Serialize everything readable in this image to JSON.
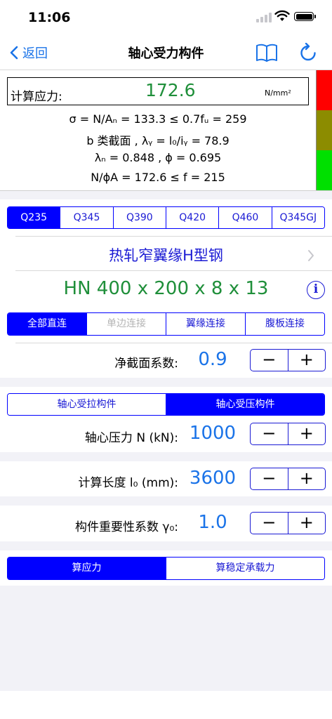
{
  "status": {
    "time": "11:06"
  },
  "nav": {
    "back_label": "返回",
    "title": "轴心受力构件"
  },
  "result": {
    "stress_label": "计算应力:",
    "stress_value": "172.6",
    "stress_unit": "N/mm²",
    "line1": "σ = N/Aₙ = 133.3 ≤ 0.7fᵤ = 259",
    "line2": "b 类截面 , λᵧ = l₀/iᵧ = 78.9",
    "line3": "λₙ = 0.848 , ϕ = 0.695",
    "line4": "N/ϕA = 172.6 ≤ f = 215",
    "colors": [
      "#ff0000",
      "#8c8c00",
      "#00e000"
    ]
  },
  "steel_grades": {
    "options": [
      "Q235",
      "Q345",
      "Q390",
      "Q420",
      "Q460",
      "Q345GJ"
    ],
    "selected": 0
  },
  "section": {
    "type_label": "热轧窄翼缘H型钢",
    "profile_label": "HN 400 x 200 x 8 x 13",
    "info_icon": "i"
  },
  "connection": {
    "options": [
      "全部直连",
      "单边连接",
      "翼缘连接",
      "腹板连接"
    ],
    "selected": 0,
    "disabled": [
      1
    ]
  },
  "net_section": {
    "label": "净截面系数:",
    "value": "0.9"
  },
  "member_type": {
    "options": [
      "轴心受拉构件",
      "轴心受压构件"
    ],
    "selected": 1
  },
  "axial_force": {
    "label": "轴心压力  N (kN):",
    "value": "1000"
  },
  "calc_length": {
    "label": "计算长度  l₀ (mm):",
    "value": "3600"
  },
  "importance": {
    "label": "构件重要性系数  γ₀:",
    "value": "1.0"
  },
  "steppers": {
    "minus": "−",
    "plus": "+"
  },
  "calc_mode": {
    "options": [
      "算应力",
      "算稳定承载力"
    ],
    "selected": 0
  }
}
